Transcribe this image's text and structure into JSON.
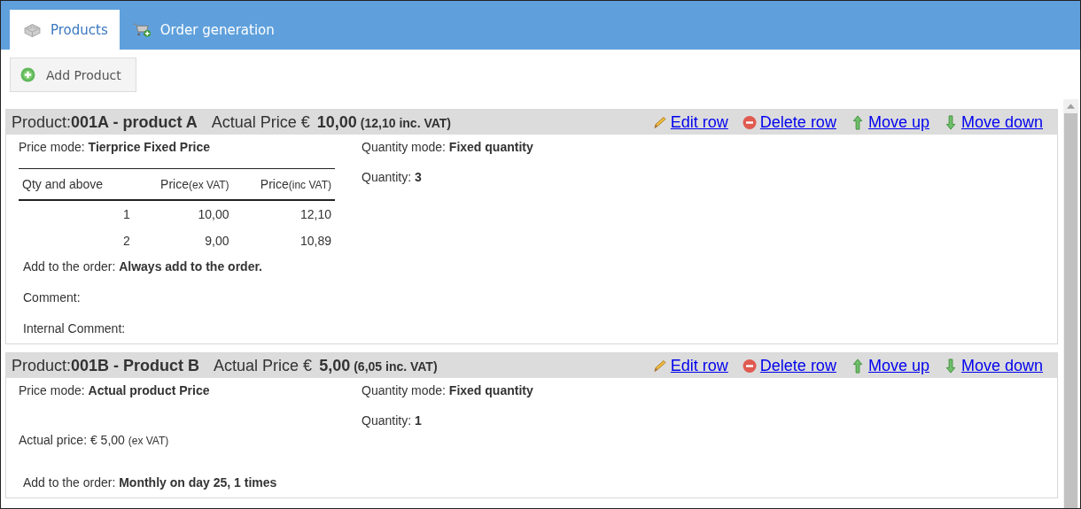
{
  "tabs": [
    {
      "label": "Products",
      "kind": "products",
      "selected": true
    },
    {
      "label": "Order generation",
      "kind": "cart",
      "selected": false
    }
  ],
  "toolbar": {
    "add_button": "Add Product"
  },
  "products": [
    {
      "title": "Product:**001A - product A**",
      "price_label": "Actual Price €",
      "price": "10,00",
      "price_vat": "(12,10 inc. VAT)",
      "actions": [
        {
          "kind": "edit",
          "label": "Edit row"
        },
        {
          "kind": "delete",
          "label": "Delete row"
        },
        {
          "kind": "up",
          "label": "Move up"
        },
        {
          "kind": "down",
          "label": "Move down"
        }
      ],
      "price_mode": "Price mode: **Tierprice Fixed Price**",
      "tier_table": {
        "columns": [
          {
            "label": "Qty and above"
          },
          {
            "label": "Price",
            "note": "(ex VAT)"
          },
          {
            "label": "Price",
            "note": "(inc VAT)"
          }
        ],
        "rows": [
          [
            "1",
            "10,00",
            "12,10"
          ],
          [
            "2",
            "9,00",
            "10,89"
          ]
        ]
      },
      "add_to_order": "Add to the order:  **Always add to the order.**",
      "comments": [
        "Comment:",
        "Internal Comment:"
      ],
      "quantity_mode": "Quantity mode: **Fixed quantity**",
      "quantity": "Quantity:  **3**"
    },
    {
      "title": "Product:**001B - Product B**",
      "price_label": "Actual Price €",
      "price": "5,00",
      "price_vat": "(6,05 inc. VAT)",
      "actions": [
        {
          "kind": "edit",
          "label": "Edit row"
        },
        {
          "kind": "delete",
          "label": "Delete row"
        },
        {
          "kind": "up",
          "label": "Move up"
        },
        {
          "kind": "down",
          "label": "Move down"
        }
      ],
      "price_mode": "Price mode: **Actual product Price**",
      "actual_price": {
        "text": "Actual price: € 5,00",
        "note": "(ex VAT)"
      },
      "add_to_order": "Add to the order:  **Monthly on day 25, 1 times**",
      "quantity_mode": "Quantity mode: **Fixed quantity**",
      "quantity": "Quantity:  **1**"
    }
  ]
}
